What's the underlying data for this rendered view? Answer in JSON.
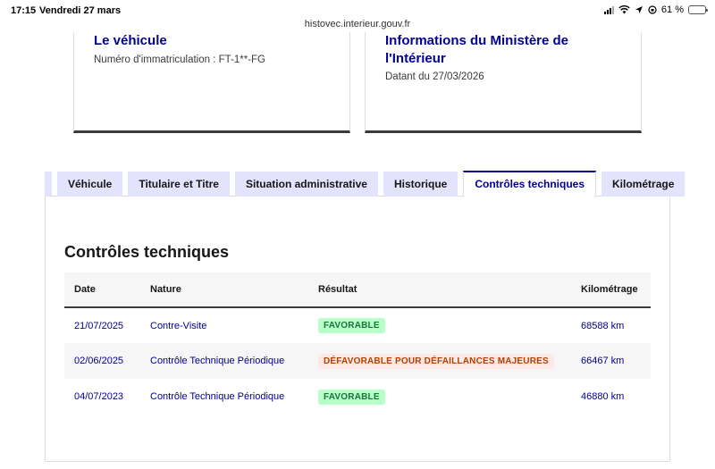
{
  "status_bar": {
    "time": "17:15",
    "date": "Vendredi 27 mars",
    "battery": "61 %",
    "battery_level": 0.61
  },
  "browser": {
    "url": "histovec.interieur.gouv.fr"
  },
  "cards": {
    "vehicle": {
      "title": "Le véhicule",
      "plate_line": "Numéro d'immatriculation : FT-1**-FG"
    },
    "ministry": {
      "title": "Informations du Ministère de l'Intérieur",
      "date_line": "Datant du 27/03/2026"
    }
  },
  "tabs": [
    {
      "label": "Véhicule"
    },
    {
      "label": "Titulaire et Titre"
    },
    {
      "label": "Situation administrative"
    },
    {
      "label": "Historique"
    },
    {
      "label": "Contrôles techniques",
      "active": true
    },
    {
      "label": "Kilométrage"
    }
  ],
  "section": {
    "title": "Contrôles techniques"
  },
  "table": {
    "headers": {
      "date": "Date",
      "nature": "Nature",
      "result": "Résultat",
      "km": "Kilométrage"
    },
    "rows": [
      {
        "date": "21/07/2025",
        "nature": "Contre-Visite",
        "result": "FAVORABLE",
        "km": "68588 km"
      },
      {
        "date": "02/06/2025",
        "nature": "Contrôle Technique Périodique",
        "result": "DÉFAVORABLE POUR DÉFAILLANCES MAJEURES",
        "km": "66467 km"
      },
      {
        "date": "04/07/2023",
        "nature": "Contrôle Technique Périodique",
        "result": "FAVORABLE",
        "km": "46880 km"
      }
    ]
  },
  "colors": {
    "primary": "#000091",
    "success_bg": "#b8fec9",
    "success_text": "#18753c",
    "error_bg": "#ffe9e6",
    "error_text": "#b34000"
  }
}
